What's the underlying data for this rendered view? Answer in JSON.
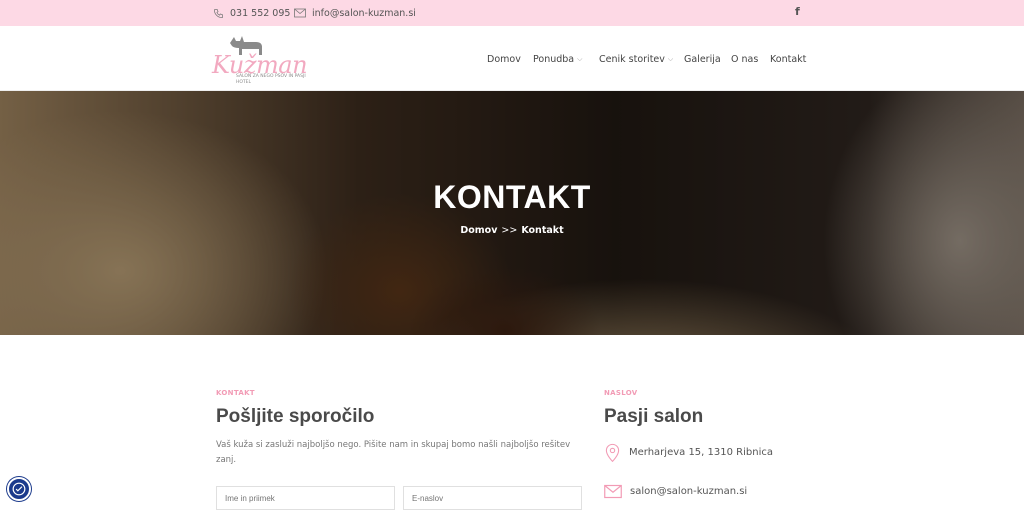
{
  "topbar": {
    "phone": "031 552 095",
    "email": "info@salon-kuzman.si",
    "social_icon": "f"
  },
  "logo": {
    "name": "Kužman",
    "tagline": "SALON ZA NEGO PSOV IN PASJI HOTEL"
  },
  "nav": {
    "items": [
      "Domov",
      "Ponudba",
      "Cenik storitev",
      "Galerija",
      "O nas",
      "Kontakt"
    ]
  },
  "hero": {
    "title": "KONTAKT",
    "breadcrumb_home": "Domov",
    "breadcrumb_sep": ">>",
    "breadcrumb_current": "Kontakt"
  },
  "form": {
    "eyebrow": "KONTAKT",
    "heading": "Pošljite sporočilo",
    "description": "Vaš kuža si zasluži najboljšo nego. Pišite nam in skupaj bomo našli najboljšo rešitev zanj.",
    "name_placeholder": "Ime in priimek",
    "email_placeholder": "E-naslov"
  },
  "address": {
    "eyebrow": "NASLOV",
    "heading": "Pasji salon",
    "street": "Merharjeva 15, 1310 Ribnica",
    "email": "salon@salon-kuzman.si"
  },
  "colors": {
    "topbar_bg": "#fdd9e5",
    "accent_pink": "#f29bb5",
    "a11y_blue": "#1b3a8c"
  }
}
